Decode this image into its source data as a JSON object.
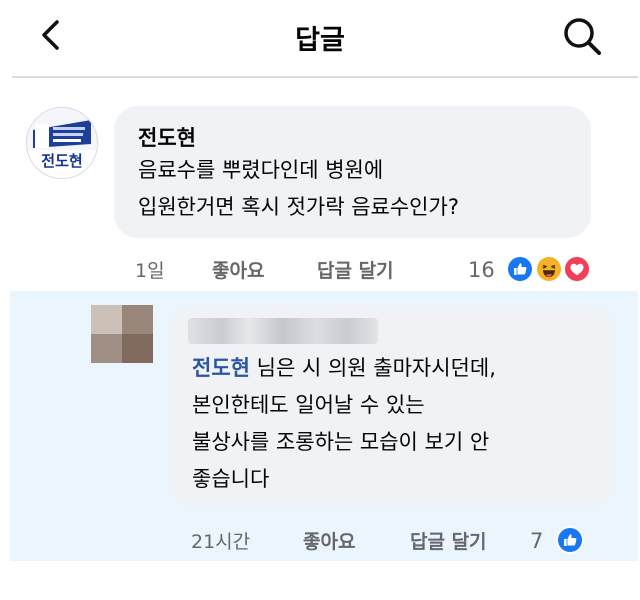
{
  "header": {
    "title": "답글"
  },
  "comment": {
    "author": "전도현",
    "avatar_text": "전도현",
    "lines": [
      "음료수를 뿌렸다인데 병원에",
      "입원한거면 혹시 젓가락 음료수인가?"
    ],
    "time": "1일",
    "like_label": "좋아요",
    "reply_label": "답글 달기",
    "reaction_count": "16",
    "reactions": [
      "like-icon",
      "haha-icon",
      "love-icon"
    ]
  },
  "reply": {
    "mention": "전도현",
    "text_after_mention": " 님은 시 의원 출마자시던데,",
    "lines": [
      "본인한테도 일어날 수 있는",
      "불상사를 조롱하는 모습이 보기 안",
      "좋습니다"
    ],
    "time": "21시간",
    "like_label": "좋아요",
    "reply_label": "답글 달기",
    "reaction_count": "7",
    "reactions": [
      "like-icon"
    ]
  },
  "colors": {
    "reply_background": "#ebf5fe",
    "bubble": "#f0f2f5",
    "mention": "#2a54a5",
    "like": "#1877f2",
    "love": "#f33e58",
    "haha": "#f7b125"
  }
}
